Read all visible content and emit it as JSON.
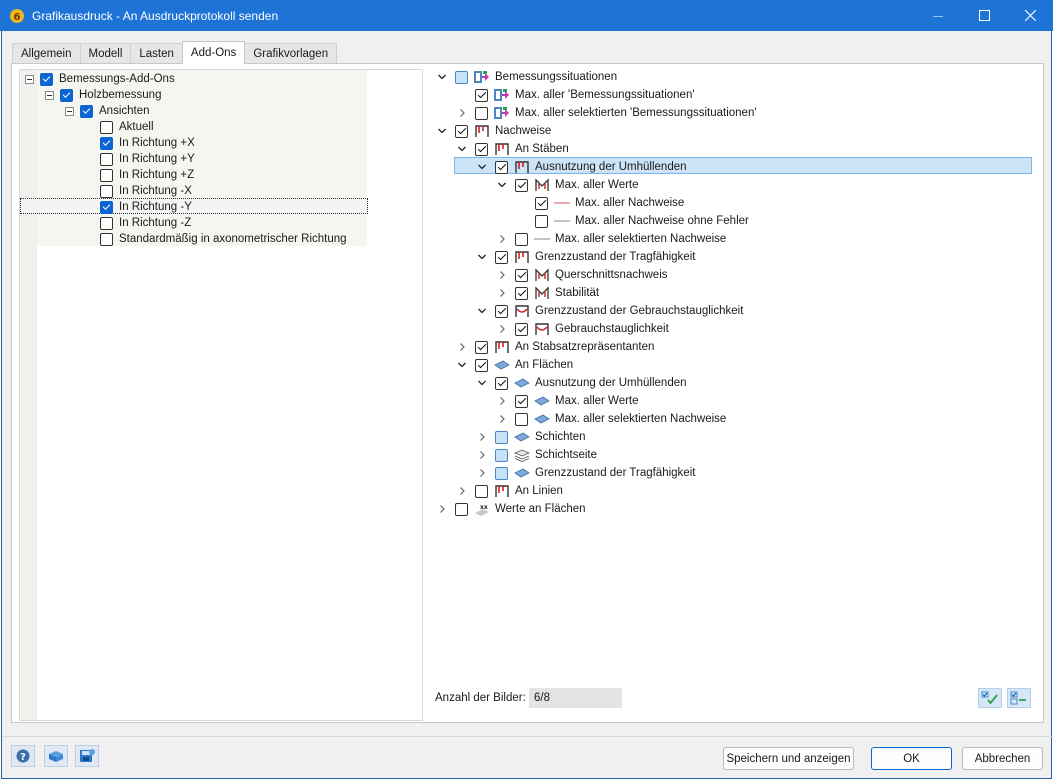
{
  "window": {
    "title": "Grafikausdruck - An Ausdruckprotokoll senden",
    "accent_color": "#1e73d6"
  },
  "tabs": [
    {
      "label": "Allgemein",
      "active": false
    },
    {
      "label": "Modell",
      "active": false
    },
    {
      "label": "Lasten",
      "active": false
    },
    {
      "label": "Add-Ons",
      "active": true
    },
    {
      "label": "Grafikvorlagen",
      "active": false
    }
  ],
  "left_tree": {
    "items": [
      {
        "label": "Bemessungs-Add-Ons",
        "checked": true,
        "expandable": true
      },
      {
        "label": "Holzbemessung",
        "checked": true,
        "expandable": true
      },
      {
        "label": "Ansichten",
        "checked": true,
        "expandable": true
      },
      {
        "label": "Aktuell",
        "checked": false
      },
      {
        "label": "In Richtung +X",
        "checked": true
      },
      {
        "label": "In Richtung +Y",
        "checked": false
      },
      {
        "label": "In Richtung +Z",
        "checked": false
      },
      {
        "label": "In Richtung -X",
        "checked": false
      },
      {
        "label": "In Richtung -Y",
        "checked": true,
        "selected": true
      },
      {
        "label": "In Richtung -Z",
        "checked": false
      },
      {
        "label": "Standardmäßig in axonometrischer Richtung",
        "checked": false
      }
    ]
  },
  "right_tree": {
    "items": [
      {
        "label": "Bemessungssituationen",
        "state": "partial",
        "expander": "expanded",
        "icon": "design-situation-icon"
      },
      {
        "label": "Max. aller 'Bemessungssituationen'",
        "state": "checked",
        "expander": "none",
        "icon": "design-situation-icon"
      },
      {
        "label": "Max. aller selektierten 'Bemessungssituationen'",
        "state": "unchecked",
        "expander": "collapsed",
        "icon": "design-situation-icon"
      },
      {
        "label": "Nachweise",
        "state": "checked",
        "expander": "expanded",
        "icon": "member-frame-icon",
        "selected": true
      },
      {
        "label": "An Stäben",
        "state": "checked",
        "expander": "expanded",
        "icon": "member-frame-icon"
      },
      {
        "label": "Ausnutzung der Umhüllenden",
        "state": "checked",
        "expander": "expanded",
        "icon": "member-frame-icon"
      },
      {
        "label": "Max. aller Werte",
        "state": "checked",
        "expander": "expanded",
        "icon": "member-m-icon"
      },
      {
        "label": "Max. aller Nachweise",
        "state": "checked",
        "expander": "none",
        "icon": "red-line-icon"
      },
      {
        "label": "Max. aller Nachweise ohne Fehler",
        "state": "unchecked",
        "expander": "none",
        "icon": "gray-line-icon"
      },
      {
        "label": "Max. aller selektierten Nachweise",
        "state": "unchecked",
        "expander": "collapsed",
        "icon": "gray-line-icon"
      },
      {
        "label": "Grenzzustand der Tragfähigkeit",
        "state": "checked",
        "expander": "expanded",
        "icon": "member-frame-icon"
      },
      {
        "label": "Querschnittsnachweis",
        "state": "checked",
        "expander": "collapsed",
        "icon": "member-m-icon"
      },
      {
        "label": "Stabilität",
        "state": "checked",
        "expander": "collapsed",
        "icon": "member-m-icon"
      },
      {
        "label": "Grenzzustand der Gebrauchstauglichkeit",
        "state": "checked",
        "expander": "expanded",
        "icon": "member-deflection-icon"
      },
      {
        "label": "Gebrauchstauglichkeit",
        "state": "checked",
        "expander": "collapsed",
        "icon": "member-deflection-icon"
      },
      {
        "label": "An Stabsatzrepräsentanten",
        "state": "checked",
        "expander": "collapsed",
        "icon": "member-frame-icon"
      },
      {
        "label": "An Flächen",
        "state": "checked",
        "expander": "expanded",
        "icon": "surface-icon"
      },
      {
        "label": "Ausnutzung der Umhüllenden",
        "state": "checked",
        "expander": "expanded",
        "icon": "surface-icon"
      },
      {
        "label": "Max. aller Werte",
        "state": "checked",
        "expander": "collapsed",
        "icon": "surface-icon"
      },
      {
        "label": "Max. aller selektierten Nachweise",
        "state": "unchecked",
        "expander": "collapsed",
        "icon": "surface-icon"
      },
      {
        "label": "Schichten",
        "state": "partial",
        "expander": "collapsed",
        "icon": "surface-icon"
      },
      {
        "label": "Schichtseite",
        "state": "partial",
        "expander": "collapsed",
        "icon": "layers-icon"
      },
      {
        "label": "Grenzzustand der Tragfähigkeit",
        "state": "partial",
        "expander": "collapsed",
        "icon": "surface-icon"
      },
      {
        "label": "An Linien",
        "state": "unchecked",
        "expander": "collapsed",
        "icon": "member-frame-icon"
      },
      {
        "label": "Werte an Flächen",
        "state": "unchecked",
        "expander": "collapsed",
        "icon": "xx-values-icon"
      }
    ]
  },
  "footer": {
    "images_label": "Anzahl der Bilder:",
    "images_value": "6/8"
  },
  "buttons": {
    "save_show": "Speichern und anzeigen",
    "ok": "OK",
    "cancel": "Abbrechen"
  }
}
